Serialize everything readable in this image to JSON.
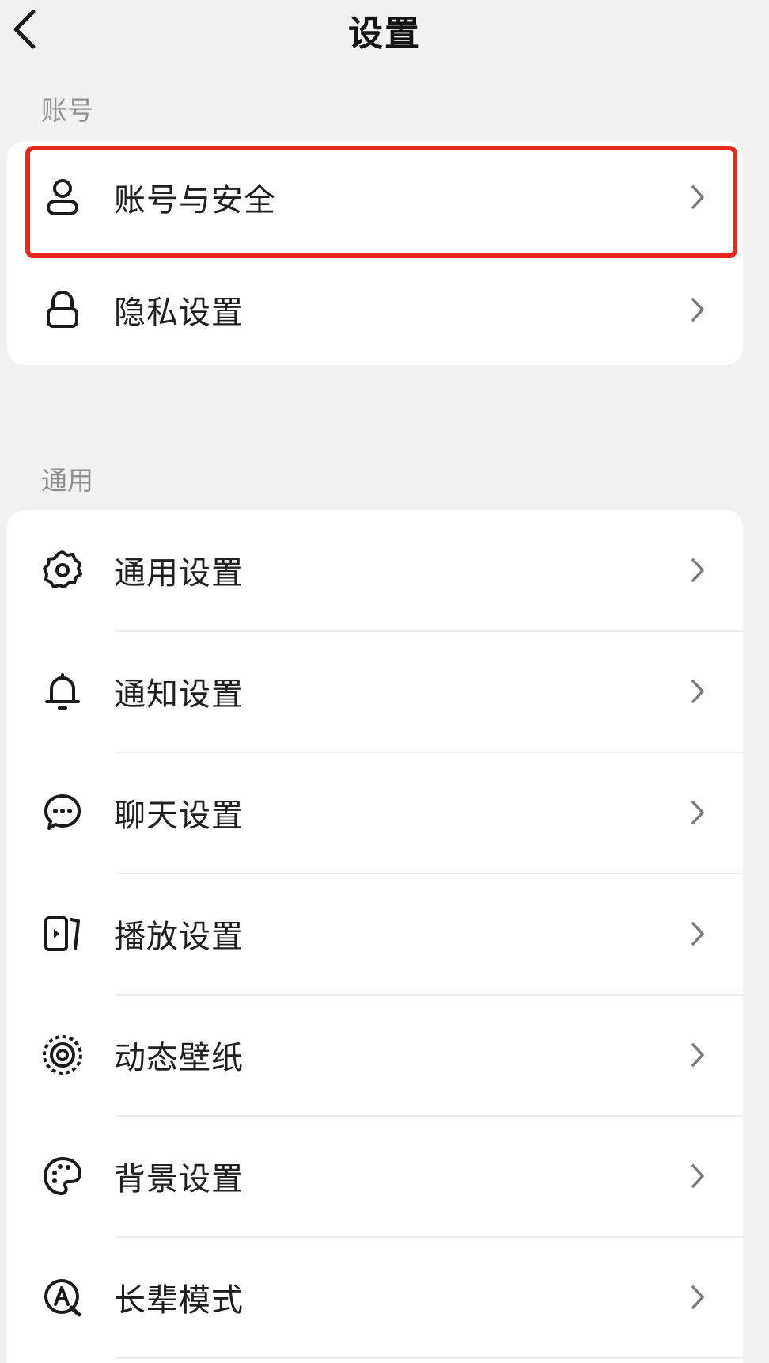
{
  "header": {
    "title": "设置",
    "back_icon": "back-arrow-icon"
  },
  "sections": [
    {
      "label": "账号",
      "items": [
        {
          "label": "账号与安全",
          "icon": "user-icon"
        },
        {
          "label": "隐私设置",
          "icon": "lock-icon"
        }
      ]
    },
    {
      "label": "通用",
      "items": [
        {
          "label": "通用设置",
          "icon": "gear-icon"
        },
        {
          "label": "通知设置",
          "icon": "bell-icon"
        },
        {
          "label": "聊天设置",
          "icon": "chat-bubble-icon"
        },
        {
          "label": "播放设置",
          "icon": "play-screen-icon"
        },
        {
          "label": "动态壁纸",
          "icon": "live-wallpaper-icon"
        },
        {
          "label": "背景设置",
          "icon": "palette-icon"
        },
        {
          "label": "长辈模式",
          "icon": "elder-mode-icon"
        }
      ]
    }
  ],
  "highlight": {
    "color": "#e8271f",
    "target": "账号与安全"
  },
  "colors": {
    "background": "#f1f1f1",
    "card": "#ffffff",
    "section_label": "#8e8e8e",
    "chevron": "#7a7a7a"
  }
}
